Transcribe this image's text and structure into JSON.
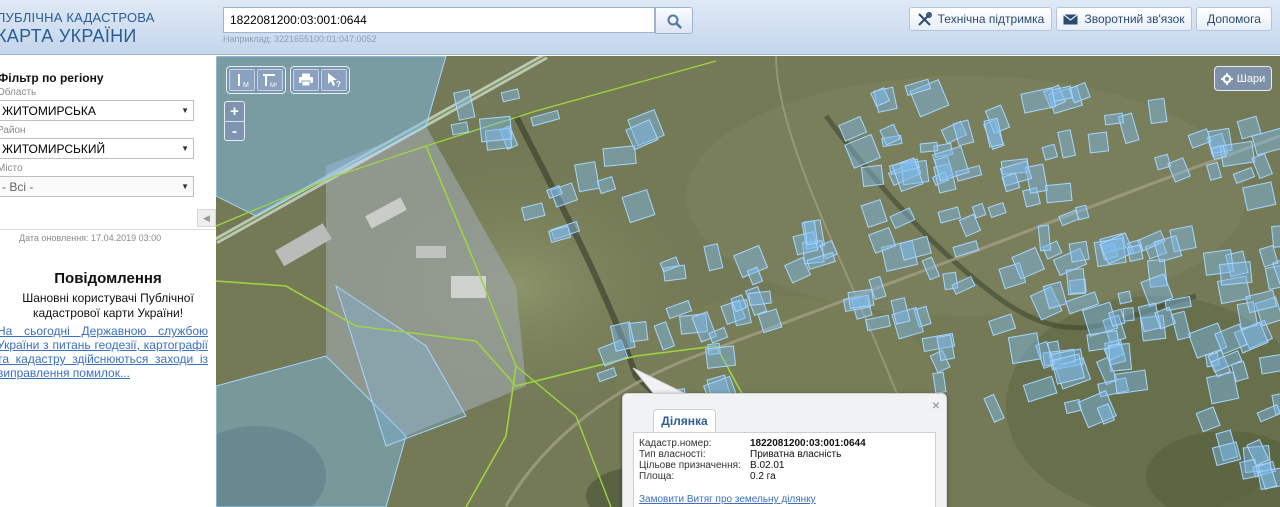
{
  "header": {
    "logo_line1": "ПУБЛІЧНА КАДАСТРОВА",
    "logo_line2": "КАРТА УКРАЇНИ",
    "search_value": "1822081200:03:001:0644",
    "search_hint": "Наприклад: 3221655100:01:047:0052",
    "support_label": "Технічна підтримка",
    "feedback_label": "Зворотний зв'язок",
    "help_label": "Допомога"
  },
  "sidebar": {
    "filter_title": "Фільтр по регіону",
    "region_label": "Область",
    "region_value": "ЖИТОМИРСЬКА",
    "district_label": "Район",
    "district_value": "ЖИТОМИРСЬКИЙ",
    "city_label": "Місто",
    "city_value": "- Всі -",
    "update_date": "Дата оновлення: 17.04.2019 03:00",
    "news_title": "Повідомлення",
    "news_text": "Шановні користувачі Публічної кадастрової карти України!",
    "news_link": "На сьогодні Державною службою України з питань геодезії, картографії та кадастру здійснюються заходи із виправлення помилок..."
  },
  "map": {
    "zoom_in": "+",
    "zoom_out": "-",
    "layers_label": "Шари",
    "popup": {
      "tab_label": "Ділянка",
      "rows": [
        {
          "key": "Кадастр.номер:",
          "value": "1822081200:03:001:0644"
        },
        {
          "key": "Тип власності:",
          "value": "Приватна власність"
        },
        {
          "key": "Цільове призначення:",
          "value": "В.02.01"
        },
        {
          "key": "Площа:",
          "value": "0.2 га"
        }
      ],
      "order_link": "Замовити Витяг про земельну ділянку"
    }
  },
  "colors": {
    "parcel_fill": "#7fbdf0",
    "parcel_stroke": "#a6d6ff",
    "boundary_green": "#9bd640",
    "link_blue": "#3a6fc4",
    "brand_blue": "#2a5d95"
  },
  "icons": [
    "search-icon",
    "tools-icon",
    "mail-icon",
    "ruler-icon",
    "area-icon",
    "print-icon",
    "identify-icon",
    "layers-icon",
    "close-icon"
  ]
}
